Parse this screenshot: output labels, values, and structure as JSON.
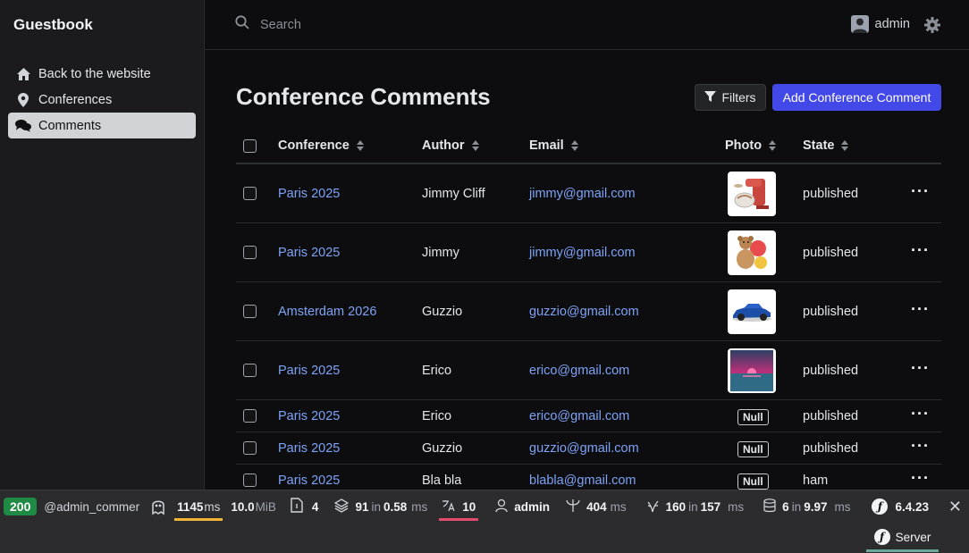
{
  "sidebar": {
    "brand": "Guestbook",
    "items": [
      {
        "label": "Back to the website",
        "icon": "home-icon"
      },
      {
        "label": "Conferences",
        "icon": "map-pin-icon"
      },
      {
        "label": "Comments",
        "icon": "comments-icon",
        "active": true
      }
    ]
  },
  "topbar": {
    "search_placeholder": "Search",
    "user_name": "admin"
  },
  "page": {
    "title": "Conference Comments",
    "filters_label": "Filters",
    "add_label": "Add Conference Comment"
  },
  "table": {
    "columns": [
      "Conference",
      "Author",
      "Email",
      "Photo",
      "State"
    ],
    "rows": [
      {
        "conference": "Paris 2025",
        "author": "Jimmy Cliff",
        "email": "jimmy@gmail.com",
        "photo": "mixer-image",
        "state": "published"
      },
      {
        "conference": "Paris 2025",
        "author": "Jimmy",
        "email": "jimmy@gmail.com",
        "photo": "teddy-bear-image",
        "state": "published"
      },
      {
        "conference": "Amsterdam 2026",
        "author": "Guzzio",
        "email": "guzzio@gmail.com",
        "photo": "blue-car-image",
        "state": "published"
      },
      {
        "conference": "Paris 2025",
        "author": "Erico",
        "email": "erico@gmail.com",
        "photo": "sunset-image",
        "state": "published"
      },
      {
        "conference": "Paris 2025",
        "author": "Erico",
        "email": "erico@gmail.com",
        "photo": "Null",
        "state": "published"
      },
      {
        "conference": "Paris 2025",
        "author": "Guzzio",
        "email": "guzzio@gmail.com",
        "photo": "Null",
        "state": "published"
      },
      {
        "conference": "Paris 2025",
        "author": "Bla bla",
        "email": "blabla@gmail.com",
        "photo": "Null",
        "state": "ham"
      }
    ]
  },
  "debug_toolbar": {
    "status_code": "200",
    "route": "@admin_commer",
    "time_value": "1145",
    "time_unit": "ms",
    "memory_value": "10.0",
    "memory_unit": "MiB",
    "forms_count": "4",
    "cache_calls": "91",
    "cache_in": "in",
    "cache_time": "0.58",
    "cache_unit": "ms",
    "translations": "10",
    "user": "admin",
    "http_value": "404",
    "http_unit": "ms",
    "twig_value": "160",
    "twig_in": "in",
    "twig_time": "157",
    "twig_unit": "ms",
    "db_queries": "6",
    "db_in": "in",
    "db_time": "9.97",
    "db_unit": "ms",
    "symfony_version": "6.4.23",
    "server_label": "Server",
    "colors": {
      "status_ok": "#1f8a43",
      "time_underline": "#f1b434",
      "translation_underline": "#e24b6d",
      "server_underline": "#6aa79a"
    }
  },
  "colors": {
    "primary_button": "#4348e8",
    "link": "#7ea3f6",
    "sidebar_bg": "#1b1b1d",
    "page_bg": "#0d0d0f"
  }
}
